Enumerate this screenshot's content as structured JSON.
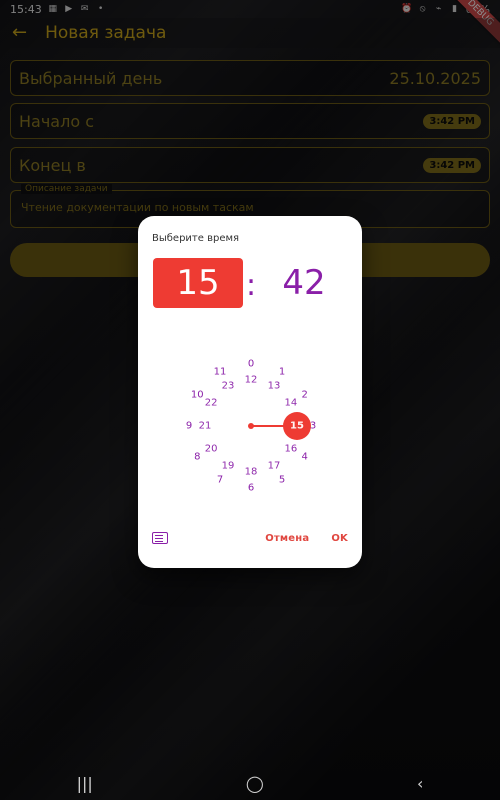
{
  "statusbar": {
    "time": "15:43",
    "battery": "62%"
  },
  "appbar": {
    "title": "Новая задача"
  },
  "form": {
    "selected_day_label": "Выбранный день",
    "selected_day_value": "25.10.2025",
    "start_label": "Начало с",
    "start_value": "3:42 PM",
    "end_label": "Конец в",
    "end_value": "3:42 PM",
    "description_label": "Описание задачи",
    "description_value": "Чтение документации по новым таскам"
  },
  "dialog": {
    "title": "Выберите время",
    "hour": "15",
    "colon": ":",
    "minute": "42",
    "cancel": "Отмена",
    "ok": "OK",
    "outer_numbers": [
      "0",
      "1",
      "2",
      "3",
      "4",
      "5",
      "6",
      "7",
      "8",
      "9",
      "10",
      "11"
    ],
    "inner_numbers": [
      "12",
      "13",
      "14",
      "15",
      "16",
      "17",
      "18",
      "19",
      "20",
      "21",
      "22",
      "23"
    ],
    "selected_hour": "15",
    "accent_color": "#ee3b33",
    "primary_color": "#8a1fa8"
  },
  "debug_banner": {
    "text": "DEBUG"
  },
  "navbar": {
    "recent": "|||",
    "home": "◯",
    "back": "‹"
  }
}
